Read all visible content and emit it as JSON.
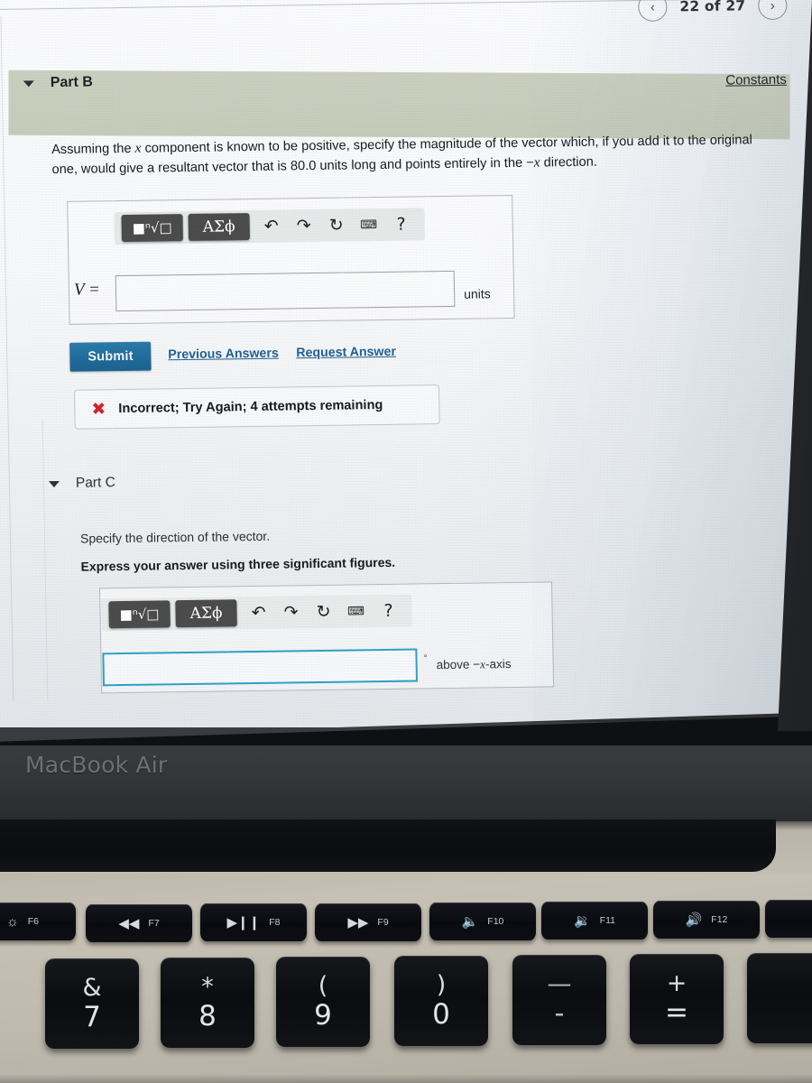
{
  "pager": {
    "prev_icon": "chevron-left-icon",
    "next_icon": "chevron-right-icon",
    "label": "22 of 27",
    "current": 22,
    "total": 27
  },
  "constants_link": "Constants",
  "part_b": {
    "title": "Part B",
    "caret": "▼",
    "question": "Assuming the x component is known to be positive, specify the magnitude of the vector which, if you add it to the original one, would give a resultant vector that is 80.0 units long and points entirely in the −x direction.",
    "question_pre": "Assuming the ",
    "question_var1": "x",
    "question_mid": " component is known to be positive, specify the magnitude of the vector which, if you add it to the original one, would give a resultant vector that is 80.0 units long and points entirely in the −",
    "question_var2": "x",
    "question_post": " direction.",
    "toolbar": {
      "template_button": "■ⁿ√□",
      "greek_button": "ΑΣϕ",
      "undo_icon": "undo-arrow-icon",
      "redo_icon": "redo-arrow-icon",
      "reset_icon": "reset-circular-arrow-icon",
      "keyboard_icon": "keyboard-icon",
      "help_icon": "question-mark-icon",
      "help_glyph": "?"
    },
    "variable_label": "V =",
    "answer_value": "",
    "units_label": "units",
    "submit_label": "Submit",
    "previous_answers_label": "Previous Answers",
    "request_answer_label": "Request Answer",
    "feedback": {
      "icon": "red-x-icon",
      "glyph": "✖",
      "text": "Incorrect; Try Again; 4 attempts remaining",
      "color": "#d0222b",
      "attempts_remaining": 4
    }
  },
  "part_c": {
    "title": "Part C",
    "caret": "▼",
    "prompt": "Specify the direction of the vector.",
    "instruction": "Express your answer using three significant figures.",
    "toolbar": {
      "template_button": "■ⁿ√□",
      "greek_button": "ΑΣϕ",
      "undo_icon": "undo-arrow-icon",
      "redo_icon": "redo-arrow-icon",
      "reset_icon": "reset-circular-arrow-icon",
      "keyboard_icon": "keyboard-icon",
      "help_glyph": "?"
    },
    "answer_value": "",
    "degree_symbol": "°",
    "unit_label_pre": "above −",
    "unit_label_var": "x",
    "unit_label_post": "-axis",
    "focused": true
  },
  "colors": {
    "band_green": "#c6cab8",
    "submit_blue": "#1e6a99",
    "link_blue": "#1f5f94",
    "error_red": "#d0222b",
    "focus_teal": "#2e9fc4"
  },
  "laptop": {
    "brand": "MacBook Air",
    "function_keys": [
      {
        "id": "f6",
        "label": "F6",
        "glyph": "☀",
        "icon": "keyboard-backlight-icon"
      },
      {
        "id": "f7",
        "label": "F7",
        "glyph": "◀◀",
        "icon": "rewind-icon"
      },
      {
        "id": "f8",
        "label": "F8",
        "glyph": "▶❙❙",
        "icon": "play-pause-icon"
      },
      {
        "id": "f9",
        "label": "F9",
        "glyph": "▶▶",
        "icon": "fast-forward-icon"
      },
      {
        "id": "f10",
        "label": "F10",
        "glyph": "🔈",
        "icon": "mute-icon"
      },
      {
        "id": "f11",
        "label": "F11",
        "glyph": "🔉",
        "icon": "volume-down-icon"
      },
      {
        "id": "f12",
        "label": "F12",
        "glyph": "🔊",
        "icon": "volume-up-icon"
      },
      {
        "id": "power",
        "label": "",
        "glyph": "⏻",
        "icon": "power-icon"
      }
    ],
    "number_keys": [
      {
        "upper": "&",
        "lower": "7",
        "name": "key-7"
      },
      {
        "upper": "*",
        "lower": "8",
        "name": "key-8"
      },
      {
        "upper": "(",
        "lower": "9",
        "name": "key-9"
      },
      {
        "upper": ")",
        "lower": "0",
        "name": "key-0"
      },
      {
        "upper": "—",
        "lower": "-",
        "name": "key-minus"
      },
      {
        "upper": "+",
        "lower": "=",
        "name": "key-equals"
      }
    ]
  }
}
